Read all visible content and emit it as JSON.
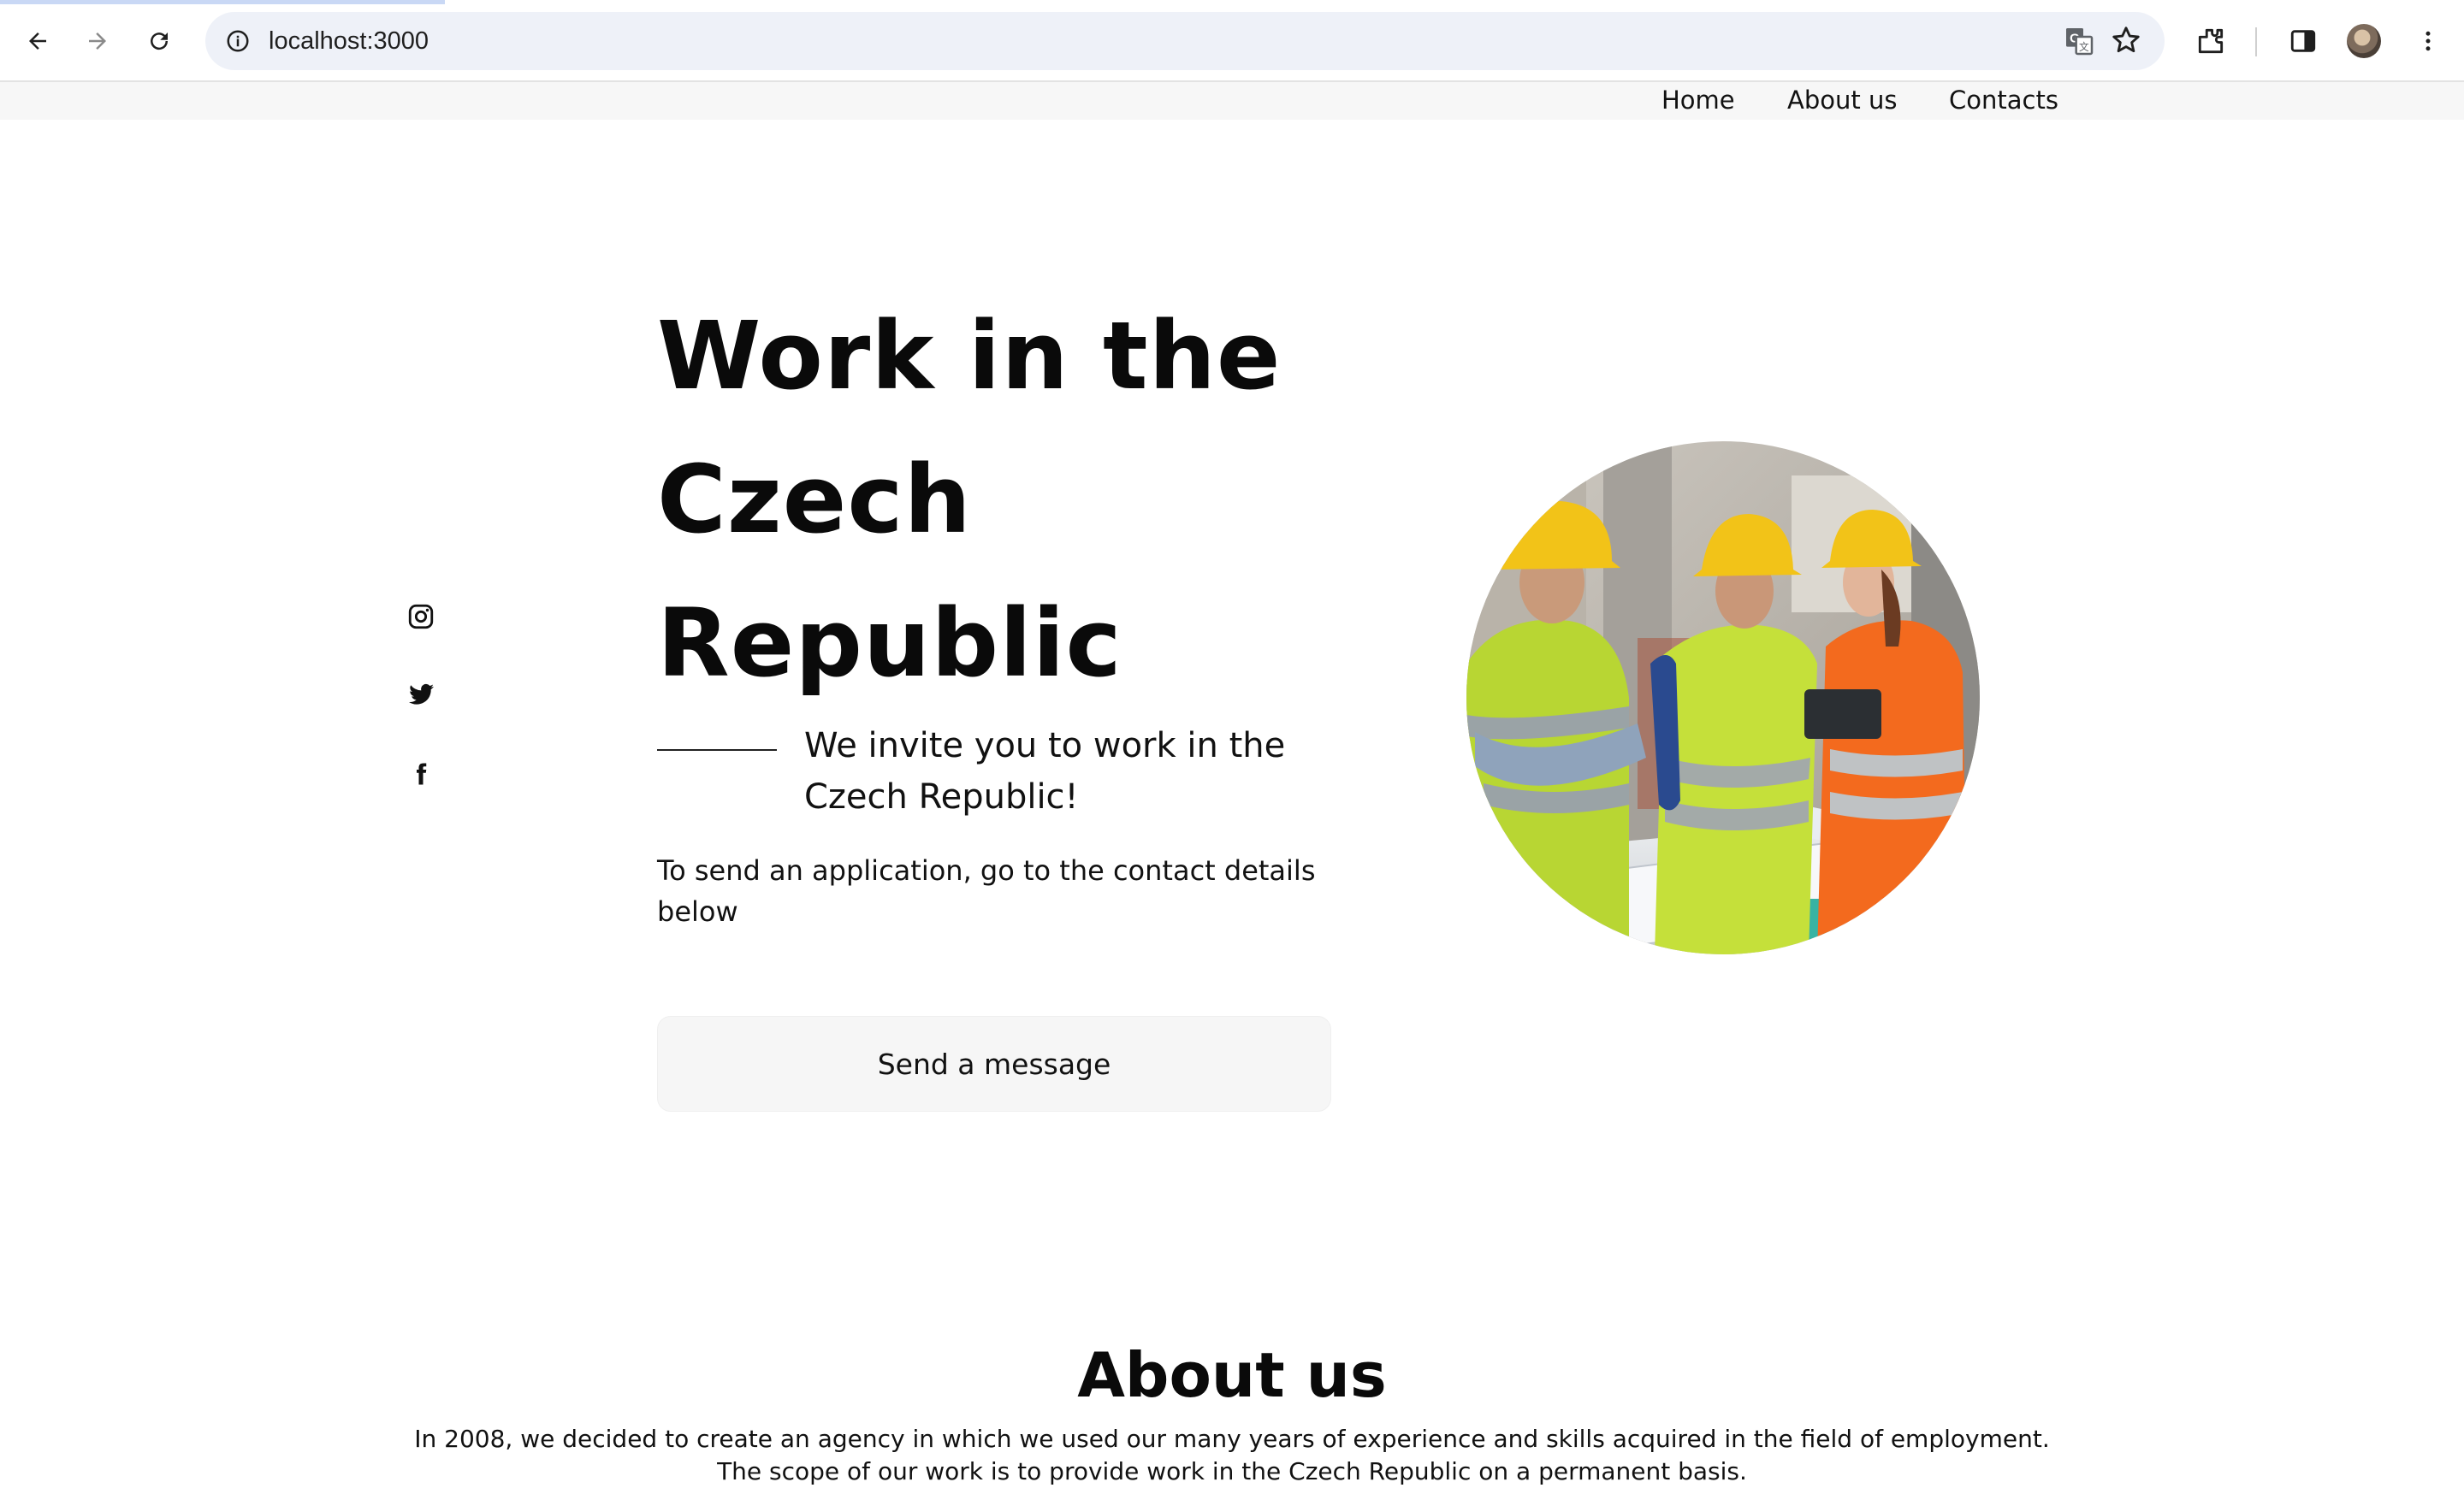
{
  "browser": {
    "url": "localhost:3000",
    "icons": [
      "back-arrow-icon",
      "forward-arrow-icon",
      "reload-icon",
      "info-icon",
      "translate-icon",
      "star-icon",
      "extensions-icon",
      "side-panel-icon",
      "profile-avatar",
      "more-vert-icon"
    ]
  },
  "nav": {
    "items": [
      {
        "label": "Home"
      },
      {
        "label": "About us"
      },
      {
        "label": "Contacts"
      }
    ]
  },
  "hero": {
    "title_line1": "Work in the",
    "title_line2": "Czech",
    "title_line3": "Republic",
    "subtitle": "We invite you to work in the Czech Republic!",
    "text": "To send an application, go to the contact details below",
    "button_label": "Send a message"
  },
  "social": {
    "icons": [
      "instagram-icon",
      "twitter-icon",
      "facebook-icon"
    ]
  },
  "about": {
    "title": "About us",
    "line1": "In 2008, we decided to create an agency in which we used our many years of experience and skills acquired in the field of employment.",
    "line2": "The scope of our work is to provide work in the Czech Republic on a permanent basis."
  },
  "colors": {
    "text": "#0a0a0a",
    "nav_bg": "#f7f7f7",
    "button_bg": "#f6f6f6",
    "omnibox_bg": "#eef1f8"
  }
}
